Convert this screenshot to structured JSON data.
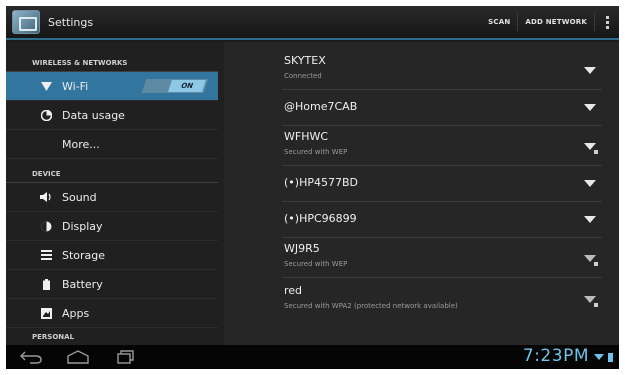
{
  "actionbar": {
    "title": "Settings",
    "scan_label": "SCAN",
    "add_network_label": "ADD NETWORK"
  },
  "sidebar": {
    "sections": [
      {
        "header": "WIRELESS & NETWORKS",
        "items": [
          {
            "label": "Wi-Fi",
            "icon": "wifi-icon",
            "toggle": "ON",
            "selected": true
          },
          {
            "label": "Data usage",
            "icon": "data-usage-icon"
          },
          {
            "label": "More...",
            "icon": ""
          }
        ]
      },
      {
        "header": "DEVICE",
        "items": [
          {
            "label": "Sound",
            "icon": "speaker-icon"
          },
          {
            "label": "Display",
            "icon": "brightness-icon"
          },
          {
            "label": "Storage",
            "icon": "storage-icon"
          },
          {
            "label": "Battery",
            "icon": "battery-icon"
          },
          {
            "label": "Apps",
            "icon": "apps-icon"
          }
        ]
      },
      {
        "header": "PERSONAL",
        "items": []
      }
    ]
  },
  "networks": [
    {
      "name": "SKYTEX",
      "status": "Connected",
      "secured": false
    },
    {
      "name": "@Home7CAB",
      "status": "",
      "secured": false
    },
    {
      "name": "WFHWC",
      "status": "Secured with WEP",
      "secured": true
    },
    {
      "name": "(•)HP4577BD",
      "status": "",
      "secured": false
    },
    {
      "name": "(•)HPC96899",
      "status": "",
      "secured": false
    },
    {
      "name": "WJ9R5",
      "status": "Secured with WEP",
      "secured": true
    },
    {
      "name": "red",
      "status": "Secured with WPA2 (protected network available)",
      "secured": true
    }
  ],
  "statusbar": {
    "time": "7:23PM"
  },
  "colors": {
    "accent": "#3276a0",
    "clock": "#6fc3ea"
  }
}
